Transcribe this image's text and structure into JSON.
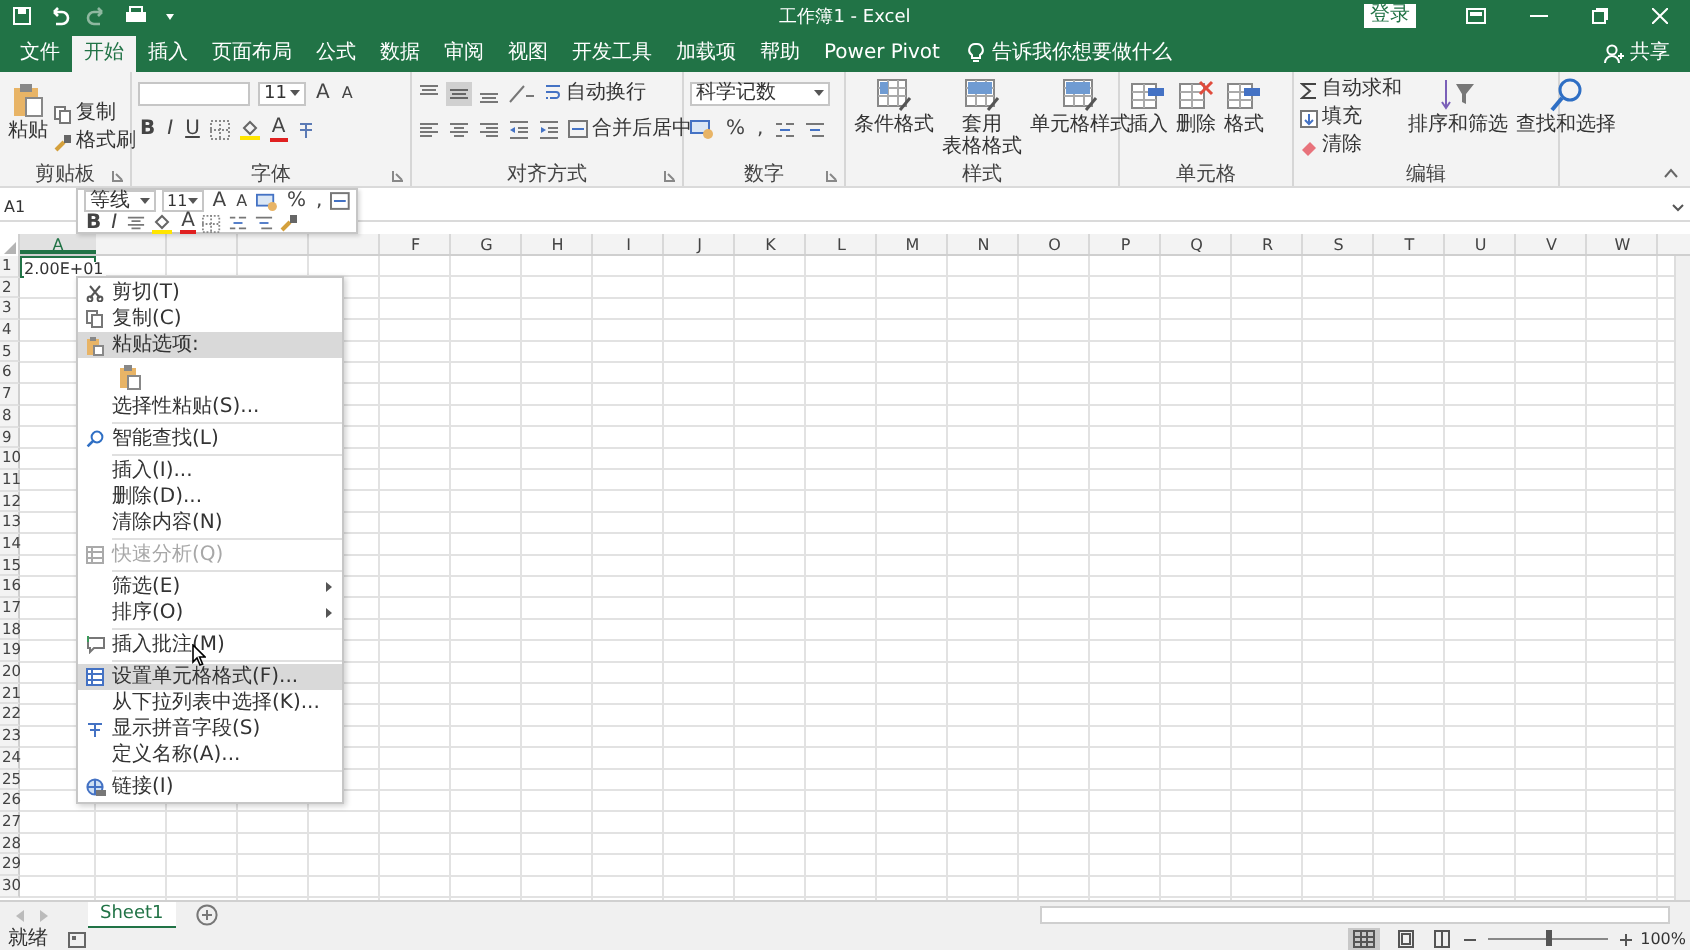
{
  "window": {
    "title": "工作簿1 - Excel",
    "login_button": "登录"
  },
  "tabs": [
    {
      "label": "文件",
      "selected": false
    },
    {
      "label": "开始",
      "selected": true
    },
    {
      "label": "插入",
      "selected": false
    },
    {
      "label": "页面布局",
      "selected": false
    },
    {
      "label": "公式",
      "selected": false
    },
    {
      "label": "数据",
      "selected": false
    },
    {
      "label": "审阅",
      "selected": false
    },
    {
      "label": "视图",
      "selected": false
    },
    {
      "label": "开发工具",
      "selected": false
    },
    {
      "label": "加载项",
      "selected": false
    },
    {
      "label": "帮助",
      "selected": false
    },
    {
      "label": "Power Pivot",
      "selected": false
    }
  ],
  "tell_me": "告诉我你想要做什么",
  "share": "共享",
  "ribbon": {
    "clipboard": {
      "label": "剪贴板",
      "paste": "粘贴",
      "items": [
        "复制",
        "格式刷"
      ]
    },
    "font": {
      "label": "字体",
      "size": "11",
      "grow": "A",
      "shrink": "A",
      "bold": "B",
      "italic": "I",
      "underline": "U",
      "font_color": "A"
    },
    "alignment": {
      "label": "对齐方式",
      "wrap_text": "自动换行",
      "merge": "合并后居中"
    },
    "number": {
      "label": "数字",
      "format": "科学记数",
      "percent": "%",
      "comma": ","
    },
    "styles": {
      "label": "样式",
      "buttons": [
        {
          "lines": [
            "条件格式"
          ]
        },
        {
          "lines": [
            "套用",
            "表格格式"
          ]
        },
        {
          "lines": [
            "单元格样式"
          ]
        }
      ]
    },
    "cells": {
      "label": "单元格",
      "buttons": [
        "插入",
        "删除",
        "格式"
      ]
    },
    "editing": {
      "label": "编辑",
      "small": [
        "自动求和",
        "填充",
        "清除"
      ],
      "big": [
        "排序和筛选",
        "查找和选择"
      ]
    }
  },
  "formula_bar": {
    "name_box": "A1"
  },
  "mini_toolbar": {
    "font": "等线",
    "size": "11",
    "grow": "A",
    "shrink": "A",
    "percent": "%",
    "comma": ",",
    "bold": "B",
    "italic": "I",
    "font_color": "A"
  },
  "columns": [
    "A",
    "F",
    "G",
    "H",
    "I",
    "J",
    "K",
    "L",
    "M",
    "N",
    "O",
    "P",
    "Q",
    "R",
    "S",
    "T",
    "U",
    "V",
    "W"
  ],
  "rows": [
    "1",
    "2",
    "3",
    "4",
    "5",
    "6",
    "7",
    "8",
    "9",
    "10",
    "11",
    "12",
    "13",
    "14",
    "15",
    "16",
    "17",
    "18",
    "19",
    "20",
    "21",
    "22",
    "23",
    "24",
    "25",
    "26",
    "27",
    "28",
    "29",
    "30"
  ],
  "cell_a1": "2.00E+01",
  "context_menu": [
    {
      "kind": "item",
      "label": "剪切(T)",
      "disabled": false,
      "selected": false,
      "submenu": false
    },
    {
      "kind": "item",
      "label": "复制(C)",
      "disabled": false,
      "selected": false,
      "submenu": false
    },
    {
      "kind": "header",
      "label": "粘贴选项:",
      "disabled": false,
      "selected": true,
      "submenu": false
    },
    {
      "kind": "paste"
    },
    {
      "kind": "item",
      "label": "选择性粘贴(S)...",
      "disabled": false,
      "selected": false,
      "submenu": false
    },
    {
      "kind": "separator"
    },
    {
      "kind": "item",
      "label": "智能查找(L)",
      "disabled": false,
      "selected": false,
      "submenu": false
    },
    {
      "kind": "separator"
    },
    {
      "kind": "item",
      "label": "插入(I)...",
      "disabled": false,
      "selected": false,
      "submenu": false
    },
    {
      "kind": "item",
      "label": "删除(D)...",
      "disabled": false,
      "selected": false,
      "submenu": false
    },
    {
      "kind": "item",
      "label": "清除内容(N)",
      "disabled": false,
      "selected": false,
      "submenu": false
    },
    {
      "kind": "separator"
    },
    {
      "kind": "item",
      "label": "快速分析(Q)",
      "disabled": true,
      "selected": false,
      "submenu": false
    },
    {
      "kind": "separator"
    },
    {
      "kind": "item",
      "label": "筛选(E)",
      "disabled": false,
      "selected": false,
      "submenu": true
    },
    {
      "kind": "item",
      "label": "排序(O)",
      "disabled": false,
      "selected": false,
      "submenu": true
    },
    {
      "kind": "separator"
    },
    {
      "kind": "item",
      "label": "插入批注(M)",
      "disabled": false,
      "selected": false,
      "submenu": false
    },
    {
      "kind": "separator"
    },
    {
      "kind": "item",
      "label": "设置单元格格式(F)...",
      "disabled": false,
      "selected": true,
      "submenu": false
    },
    {
      "kind": "item",
      "label": "从下拉列表中选择(K)...",
      "disabled": false,
      "selected": false,
      "submenu": false
    },
    {
      "kind": "item",
      "label": "显示拼音字段(S)",
      "disabled": false,
      "selected": false,
      "submenu": false
    },
    {
      "kind": "item",
      "label": "定义名称(A)...",
      "disabled": false,
      "selected": false,
      "submenu": false
    },
    {
      "kind": "separator"
    },
    {
      "kind": "item",
      "label": "链接(I)",
      "disabled": false,
      "selected": false,
      "submenu": false
    }
  ],
  "sheets": [
    {
      "label": "Sheet1",
      "selected": true
    }
  ],
  "status": "就绪",
  "zoom": {
    "level": 0.5,
    "reading": "100%"
  }
}
